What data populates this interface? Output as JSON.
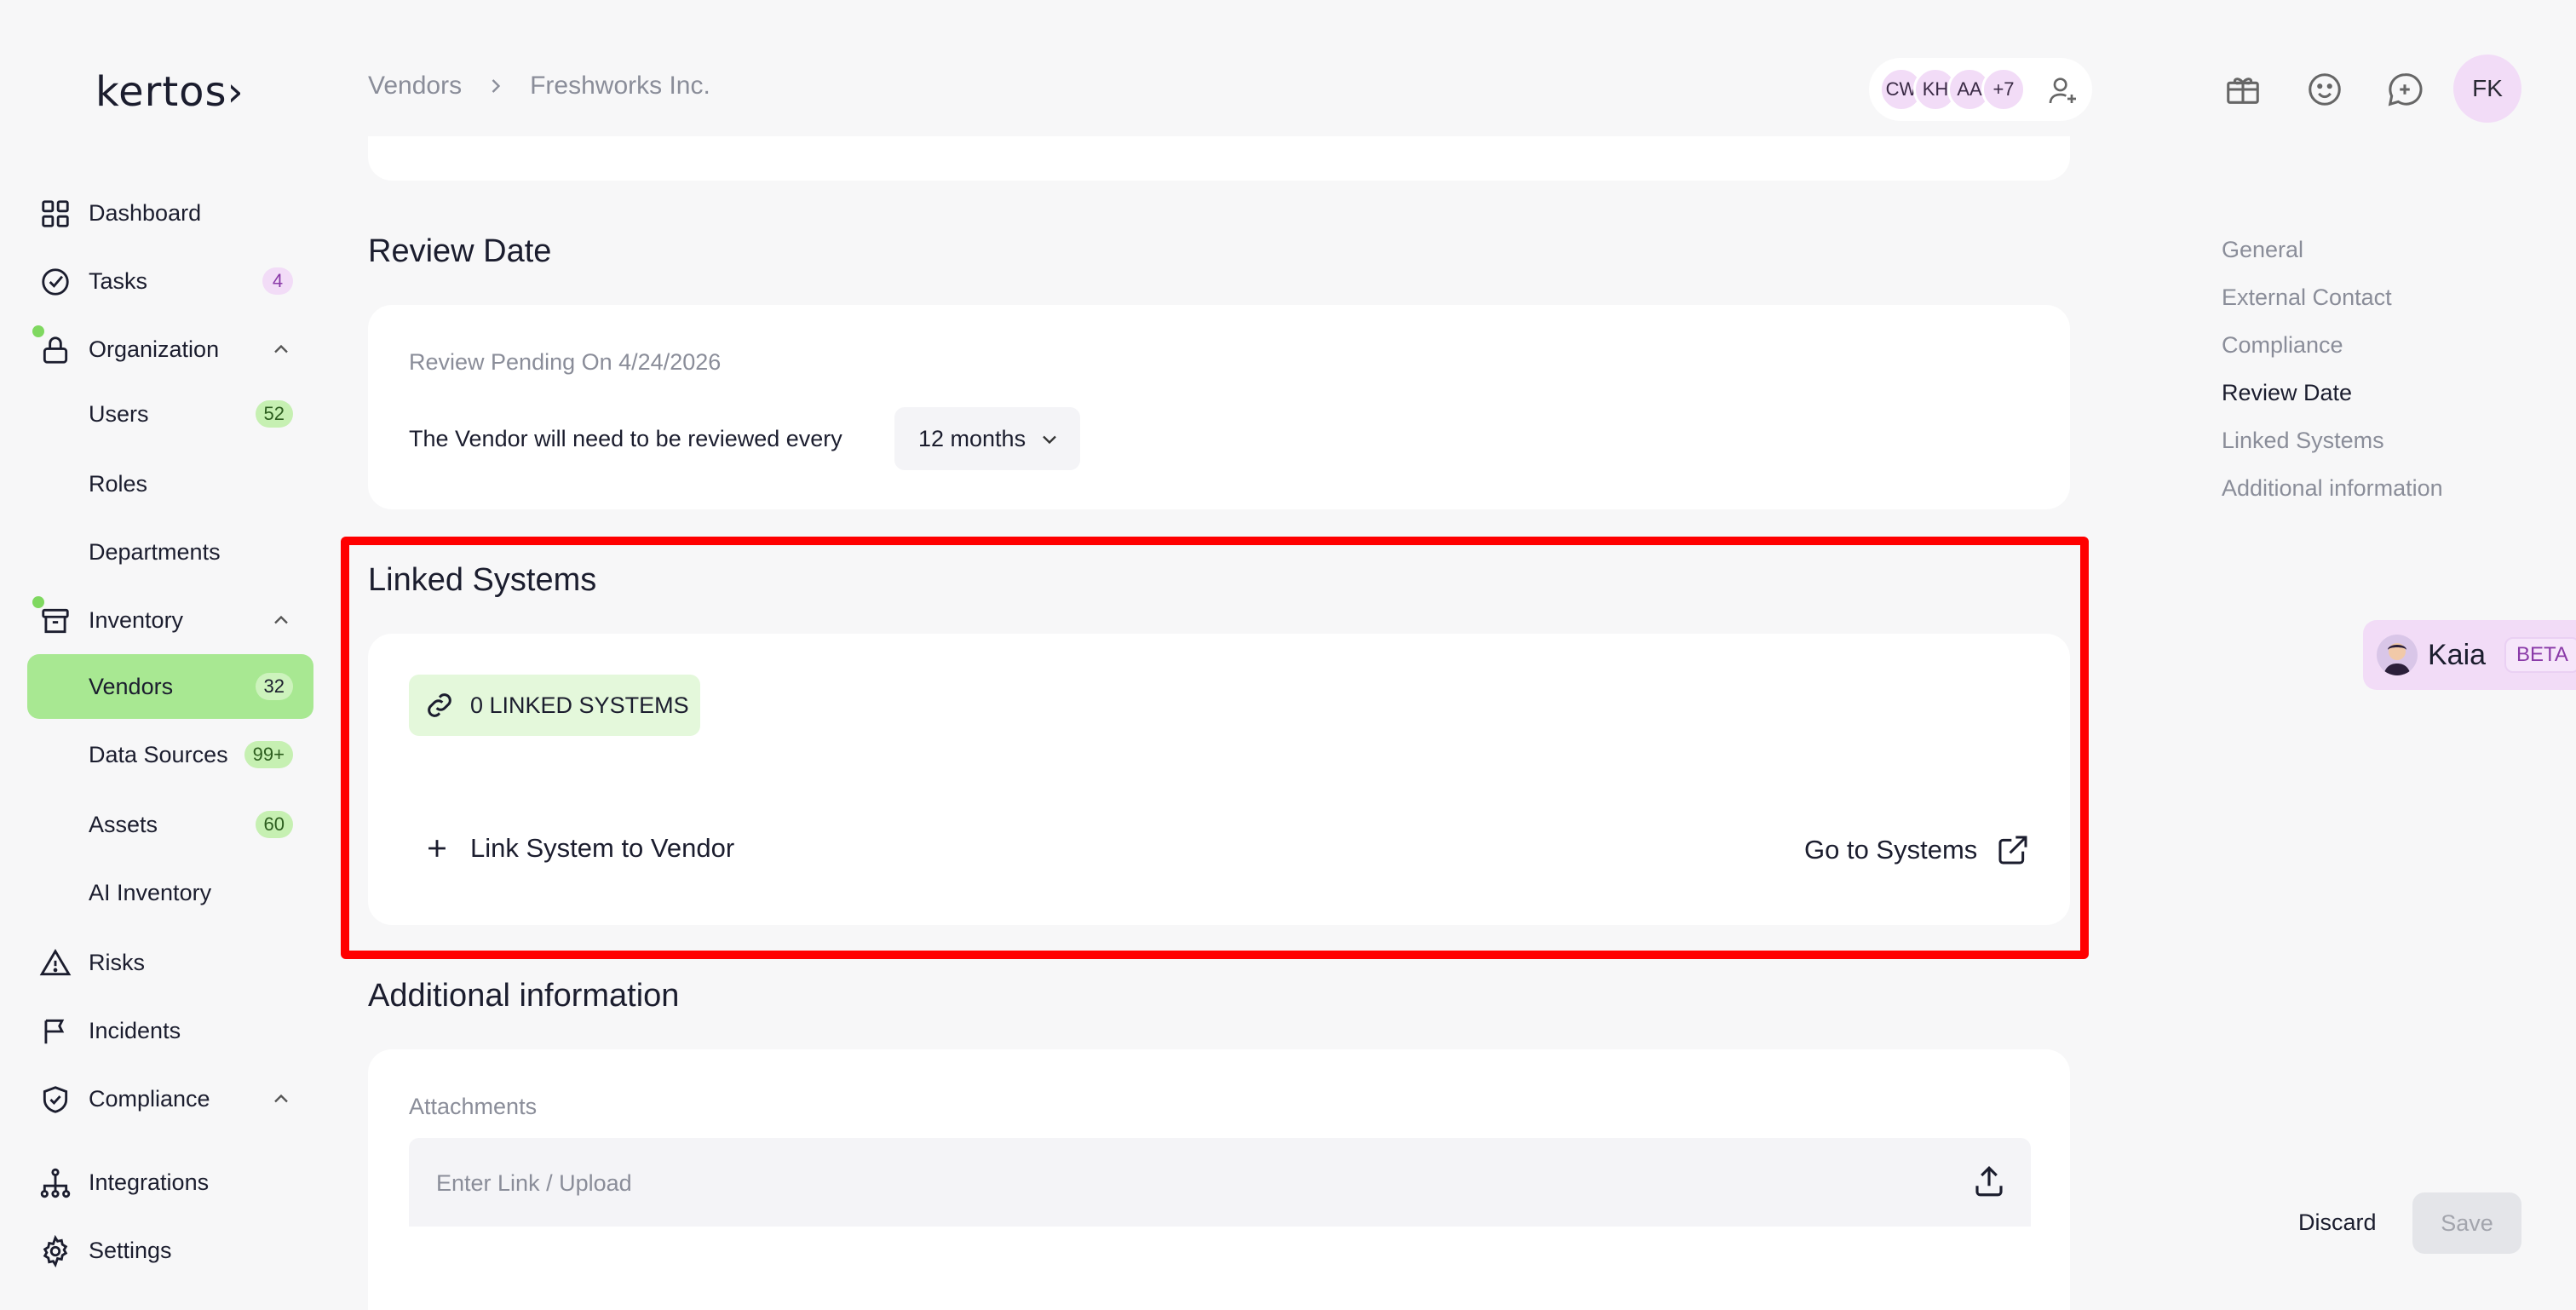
{
  "app": {
    "logo": "kertos›"
  },
  "sidebar": {
    "dashboard": "Dashboard",
    "tasks": {
      "label": "Tasks",
      "badge": "4"
    },
    "organization": "Organization",
    "users": {
      "label": "Users",
      "badge": "52"
    },
    "roles": "Roles",
    "departments": "Departments",
    "inventory": "Inventory",
    "vendors": {
      "label": "Vendors",
      "badge": "32"
    },
    "data_sources": {
      "label": "Data Sources",
      "badge": "99+"
    },
    "assets": {
      "label": "Assets",
      "badge": "60"
    },
    "ai_inventory": "AI Inventory",
    "risks": "Risks",
    "incidents": "Incidents",
    "compliance": "Compliance",
    "integrations": "Integrations",
    "settings": "Settings"
  },
  "header": {
    "breadcrumb": [
      "Vendors",
      "Freshworks Inc."
    ],
    "collaborators": [
      "CW",
      "KH",
      "AA",
      "+7"
    ],
    "user_initials": "FK"
  },
  "review": {
    "title": "Review Date",
    "pending": "Review Pending On 4/24/2026",
    "interval_label": "The Vendor will need to be reviewed every",
    "interval_value": "12 months"
  },
  "linked": {
    "title": "Linked Systems",
    "count_label": "0 LINKED SYSTEMS",
    "link_action": "Link System to Vendor",
    "goto_action": "Go to Systems"
  },
  "additional": {
    "title": "Additional information",
    "attachments_label": "Attachments",
    "upload_placeholder": "Enter Link / Upload"
  },
  "toc": [
    "General",
    "External Contact",
    "Compliance",
    "Review Date",
    "Linked Systems",
    "Additional information"
  ],
  "toc_current": "Review Date",
  "assistant": {
    "name": "Kaia",
    "tag": "BETA"
  },
  "footer": {
    "discard": "Discard",
    "save": "Save"
  },
  "colors": {
    "accent_green": "#a8e892",
    "highlight_red": "#ff0000",
    "purple_soft": "#f2dcf7"
  }
}
